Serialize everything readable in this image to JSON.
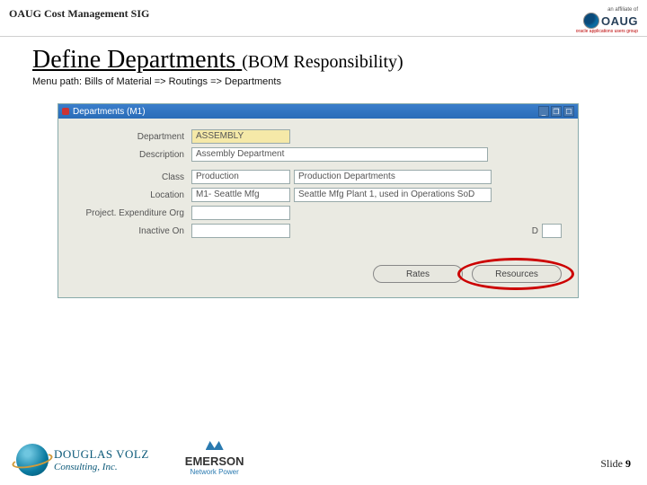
{
  "header": {
    "title": "OAUG Cost Management SIG",
    "logo_affiliate": "an affiliate of",
    "logo_name": "OAUG",
    "logo_tag": "oracle applications users group"
  },
  "slide": {
    "title_main": "Define Departments",
    "title_sub": "(BOM Responsibility)",
    "menu_path": "Menu path:  Bills of Material => Routings => Departments"
  },
  "window": {
    "title": "Departments (M1)",
    "min": "_",
    "restore": "❐",
    "max": "☐",
    "labels": {
      "department": "Department",
      "description": "Description",
      "class": "Class",
      "location": "Location",
      "proj_org": "Project. Expenditure Org",
      "inactive": "Inactive On"
    },
    "values": {
      "department": "ASSEMBLY",
      "description": "Assembly Department",
      "class": "Production",
      "class_desc": "Production Departments",
      "location": "M1- Seattle Mfg",
      "location_desc": "Seattle Mfg Plant 1, used in Operations SoD",
      "proj_org": "",
      "inactive": ""
    },
    "date_label": "D",
    "buttons": {
      "rates": "Rates",
      "resources": "Resources"
    }
  },
  "footer": {
    "dv_line1": "DOUGLAS VOLZ",
    "dv_line2": "Consulting, Inc.",
    "em_line1": "EMERSON",
    "em_line2": "Network Power",
    "slide_word": "Slide ",
    "slide_num": "9"
  }
}
